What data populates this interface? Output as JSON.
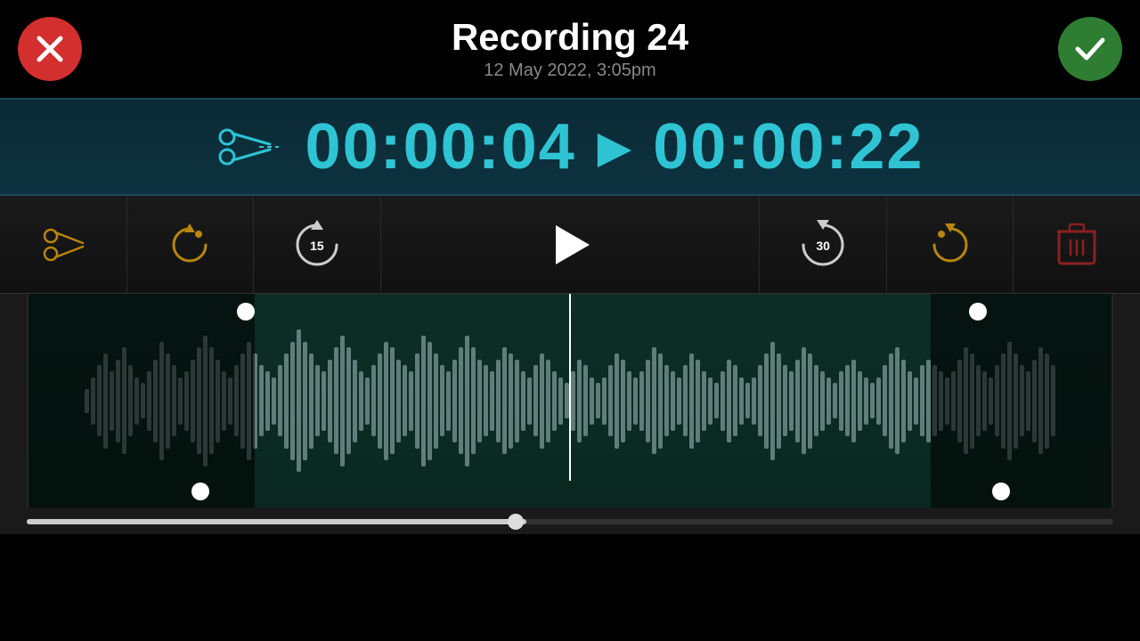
{
  "header": {
    "title": "Recording 24",
    "subtitle": "12 May 2022, 3:05pm",
    "cancel_label": "Cancel",
    "confirm_label": "Confirm"
  },
  "timer": {
    "current": "00:00:04",
    "separator": "▶",
    "total": "00:00:22"
  },
  "controls": {
    "scissors_label": "Scissors",
    "loop_back_label": "Loop Back",
    "rewind_15_label": "Rewind 15",
    "rewind_15_value": "15",
    "play_label": "Play",
    "forward_30_label": "Forward 30",
    "forward_30_value": "30",
    "loop_forward_label": "Loop Forward",
    "delete_label": "Delete"
  },
  "waveform": {
    "bars": [
      2,
      4,
      6,
      8,
      5,
      7,
      9,
      6,
      4,
      3,
      5,
      7,
      10,
      8,
      6,
      4,
      5,
      7,
      9,
      11,
      9,
      7,
      5,
      4,
      6,
      8,
      10,
      8,
      6,
      5,
      4,
      6,
      8,
      10,
      12,
      10,
      8,
      6,
      5,
      7,
      9,
      11,
      9,
      7,
      5,
      4,
      6,
      8,
      10,
      9,
      7,
      6,
      5,
      8,
      11,
      10,
      8,
      6,
      5,
      7,
      9,
      11,
      9,
      7,
      6,
      5,
      7,
      9,
      8,
      7,
      5,
      4,
      6,
      8,
      7,
      5,
      4,
      3,
      5,
      7,
      6,
      4,
      3,
      4,
      6,
      8,
      7,
      5,
      4,
      5,
      7,
      9,
      8,
      6,
      5,
      4,
      6,
      8,
      7,
      5,
      4,
      3,
      5,
      7,
      6,
      4,
      3,
      4,
      6,
      8,
      10,
      8,
      6,
      5,
      7,
      9,
      8,
      6,
      5,
      4,
      3,
      5,
      6,
      7,
      5,
      4,
      3,
      4,
      6,
      8,
      9,
      7,
      5,
      4,
      6,
      7,
      6,
      5,
      4,
      5,
      7,
      9,
      8,
      6,
      5,
      4,
      6,
      8,
      10,
      8,
      6,
      5,
      7,
      9,
      8,
      6
    ]
  },
  "colors": {
    "accent_cyan": "#2ec4d4",
    "background_dark": "#000000",
    "timer_bg": "#0a2a35",
    "waveform_selected_bg": "#0d2e25",
    "waveform_bar_selected": "#607d7a",
    "waveform_bar_unselected": "#4a5a58",
    "handle_color": "#ffffff",
    "playhead_color": "#ffffff",
    "cancel_red": "#d32f2f",
    "confirm_green": "#2e7d32"
  }
}
